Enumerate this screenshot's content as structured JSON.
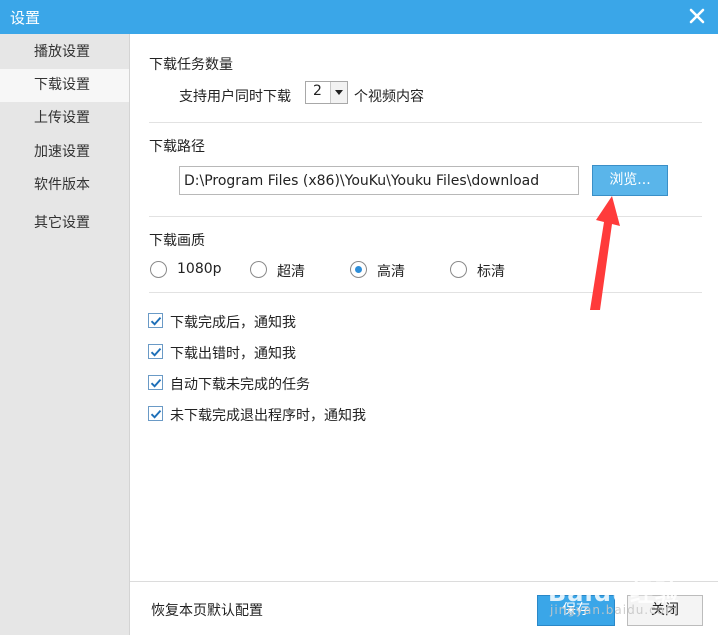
{
  "window": {
    "title": "设置"
  },
  "sidebar": {
    "items": [
      {
        "label": "播放设置",
        "active": false
      },
      {
        "label": "下载设置",
        "active": true
      },
      {
        "label": "上传设置",
        "active": false
      },
      {
        "label": "加速设置",
        "active": false
      },
      {
        "label": "软件版本",
        "active": false
      },
      {
        "label": "其它设置",
        "active": false
      }
    ]
  },
  "download_tasks": {
    "title": "下载任务数量",
    "prefix": "支持用户同时下载",
    "selected_value": "2",
    "suffix": "个视频内容"
  },
  "download_path": {
    "title": "下载路径",
    "value": "D:\\Program Files (x86)\\YouKu\\Youku Files\\download",
    "browse_label": "浏览..."
  },
  "quality": {
    "title": "下载画质",
    "options": [
      {
        "label": "1080p",
        "checked": false
      },
      {
        "label": "超清",
        "checked": false
      },
      {
        "label": "高清",
        "checked": true
      },
      {
        "label": "标清",
        "checked": false
      }
    ]
  },
  "notifications": [
    {
      "label": "下载完成后，通知我",
      "checked": true
    },
    {
      "label": "下载出错时，通知我",
      "checked": true
    },
    {
      "label": "自动下载未完成的任务",
      "checked": true
    },
    {
      "label": "未下载完成退出程序时，通知我",
      "checked": true
    }
  ],
  "footer": {
    "reset_label": "恢复本页默认配置",
    "save_label": "保存",
    "close_label": "关闭"
  },
  "watermark": {
    "logo": "Baidu经验",
    "url": "jingyan.baidu.com"
  },
  "colors": {
    "titlebar": "#3aa6e8",
    "accent": "#2e8ed8",
    "annotation_arrow": "#ff3b3b"
  }
}
